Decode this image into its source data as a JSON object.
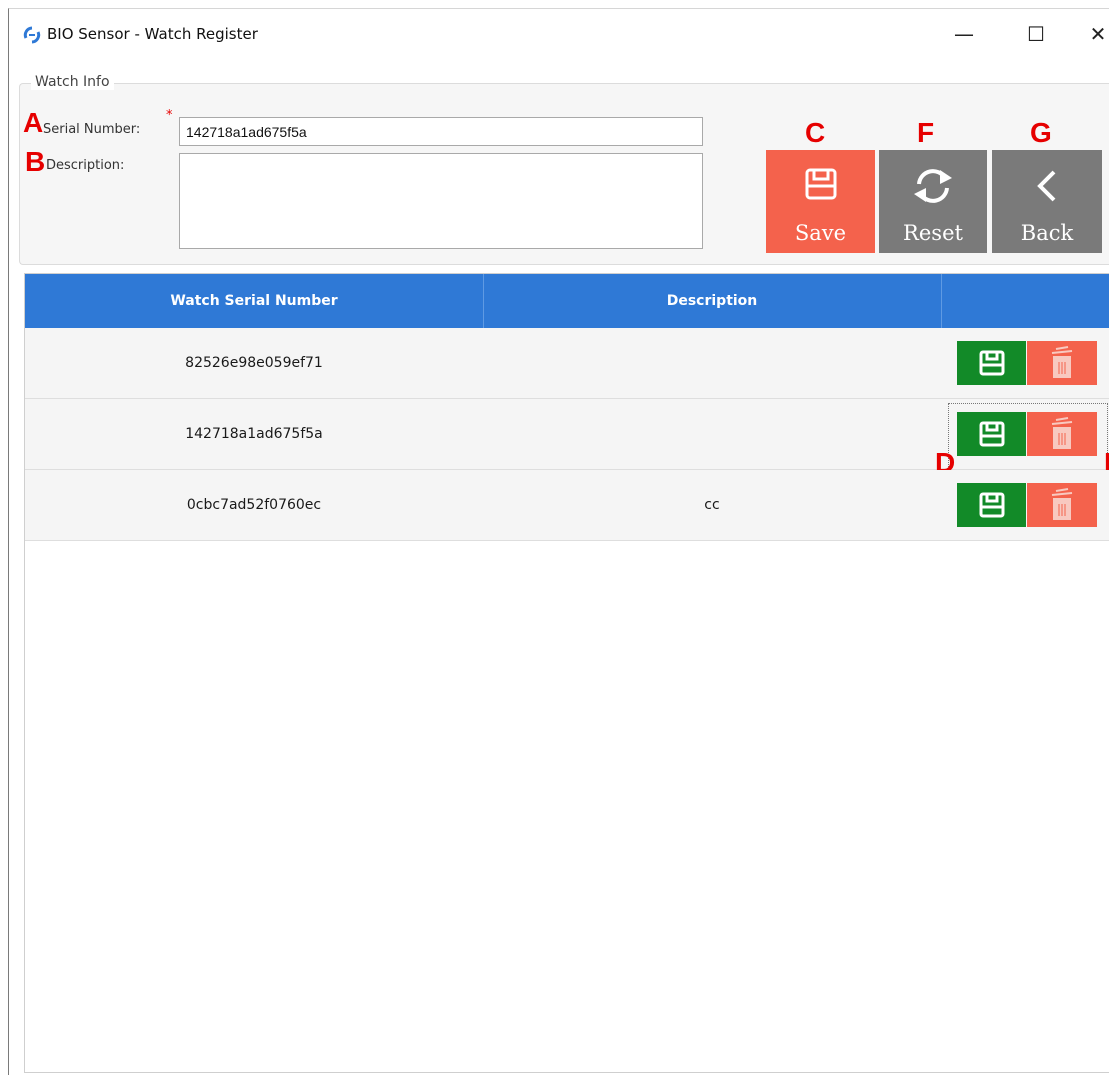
{
  "window": {
    "title": "BIO Sensor - Watch Register",
    "controls": {
      "minimize": "—",
      "maximize": "☐",
      "close": "✕"
    }
  },
  "markers": {
    "a": "A",
    "b": "B",
    "c": "C",
    "d": "D",
    "e": "E",
    "f": "F",
    "g": "G"
  },
  "watch_info": {
    "group_title": "Watch Info",
    "serial_label": "Serial Number:",
    "required_mark": "*",
    "serial_value": "142718a1ad675f5a",
    "description_label": "Description:",
    "description_value": ""
  },
  "actions": {
    "save_label": "Save",
    "reset_label": "Reset",
    "back_label": "Back",
    "save_color": "#f4624c",
    "reset_color": "#7a7a7a",
    "back_color": "#7a7a7a"
  },
  "table": {
    "header_color": "#2f79d6",
    "columns": [
      "Watch Serial Number",
      "Description",
      ""
    ],
    "rows": [
      {
        "serial": "82526e98e059ef71",
        "description": ""
      },
      {
        "serial": "142718a1ad675f5a",
        "description": ""
      },
      {
        "serial": "0cbc7ad52f0760ec",
        "description": "cc"
      }
    ],
    "row_actions": {
      "save_icon": "save-icon",
      "delete_icon": "trash-icon",
      "save_color": "#128a28",
      "delete_color": "#f4624c"
    }
  }
}
